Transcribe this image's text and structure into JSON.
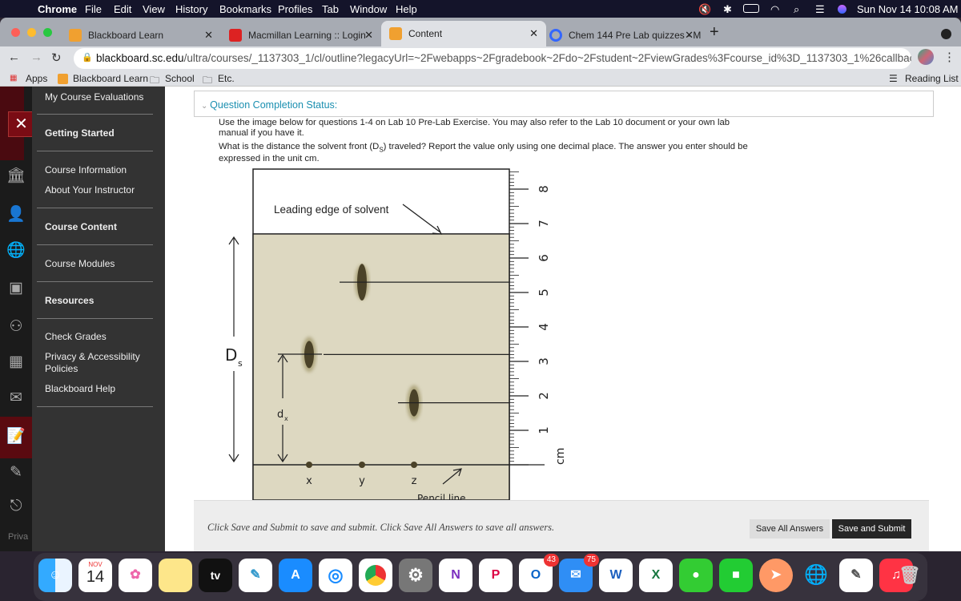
{
  "menubar": {
    "apple": "",
    "app": "Chrome",
    "items": [
      "File",
      "Edit",
      "View",
      "History",
      "Bookmarks",
      "Profiles",
      "Tab",
      "Window",
      "Help"
    ],
    "datetime": "Sun Nov 14  10:08 AM"
  },
  "tabs": [
    {
      "label": "Blackboard Learn",
      "active": false
    },
    {
      "label": "Macmillan Learning :: Login",
      "active": false
    },
    {
      "label": "Content",
      "active": true
    },
    {
      "label": "Chem 144 Pre Lab quizzes - M",
      "active": false
    }
  ],
  "new_tab": "+",
  "address": {
    "host": "blackboard.sc.edu",
    "path": "/ultra/courses/_1137303_1/cl/outline?legacyUrl=~2Fwebapps~2Fgradebook~2Fdo~2Fstudent~2FviewGrades%3Fcourse_id%3D_1137303_1%26callback%3Dc..."
  },
  "bookmarks": {
    "apps": "Apps",
    "items": [
      "Blackboard Learn",
      "School",
      "Etc."
    ],
    "reading_list": "Reading List"
  },
  "sidebar": {
    "items": [
      "My Course Evaluations",
      "Getting Started",
      "Course Information",
      "About Your Instructor",
      "Course Content",
      "Course Modules",
      "Resources",
      "Check Grades",
      "Privacy & Accessibility",
      "Policies",
      "Blackboard Help"
    ],
    "footer": "Priva"
  },
  "question": {
    "status_label": "Question Completion Status:",
    "line1": "Use the image below for questions 1-4 on Lab 10 Pre-Lab Exercise. You may also refer to the Lab 10 document or your own lab",
    "line2": "manual if you have it.",
    "line3a": "What is the distance the solvent front (D",
    "line3sub": "S",
    "line3b": ") traveled? Report the value only using one decimal place. The answer you enter should be",
    "line4": "expressed in the unit cm."
  },
  "diagram": {
    "leading_edge_label": "Leading edge of solvent",
    "ds_label": "D",
    "ds_sub": "s",
    "dx_label": "d",
    "dx_sub": "x",
    "lanes": [
      "x",
      "y",
      "z"
    ],
    "pencil_label": "Pencil line",
    "unit": "cm",
    "ruler_labels": [
      "1",
      "2",
      "3",
      "4",
      "5",
      "6",
      "7",
      "8"
    ],
    "solvent_front_cm": 6.7,
    "spots_cm": {
      "x": 3.2,
      "y": 5.3,
      "z": 1.8
    },
    "paper_color": "#ddd8c1",
    "spot_color": "#4a4228"
  },
  "footer": {
    "message": "Click Save and Submit to save and submit. Click Save All Answers to save all answers.",
    "save_all": "Save All Answers",
    "save_submit": "Save and Submit"
  },
  "dock": {
    "calendar_month": "NOV",
    "calendar_day": "14",
    "tv": "tv",
    "outlook_badge": "43",
    "mail_badge": "75",
    "onenote": "N",
    "powerpoint": "P",
    "outlook": "O",
    "word": "W",
    "excel": "X"
  }
}
